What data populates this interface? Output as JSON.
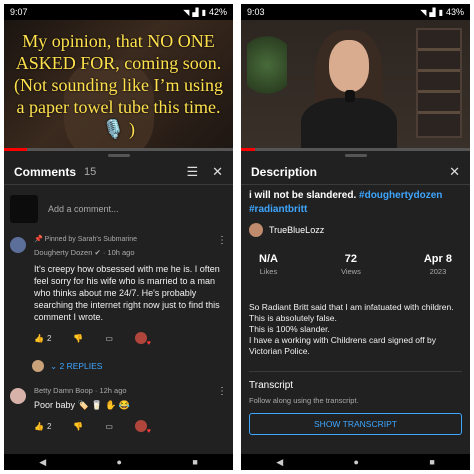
{
  "left": {
    "status": {
      "time": "9:07",
      "battery": "42%"
    },
    "video_overlay": "My opinion, that NO ONE ASKED FOR, coming soon. (Not sounding like I’m using a paper towel tube this time. 🎙️ )",
    "comments_panel": {
      "title": "Comments",
      "count": "15",
      "add_placeholder": "Add a comment...",
      "comments": [
        {
          "pinned": "Pinned by Sarah's Submarine",
          "author": "Dougherty Dozen ✔ · 10h ago",
          "text": "It's creepy how obsessed with me he is. I often feel sorry for his wife who is married to a man who thinks about me 24/7. He's probably searching the internet right now just to find this comment I wrote.",
          "likes": "2",
          "replies": "2 REPLIES"
        },
        {
          "author": "Betty Damn Boop · 12h ago",
          "text": "Poor baby 🏷️ 🥛 ✋ 😂",
          "likes": "2"
        }
      ]
    }
  },
  "right": {
    "status": {
      "time": "9:03",
      "battery": "43%"
    },
    "description_panel": {
      "title": "Description",
      "heading": "i will not be slandered.",
      "hashtags": [
        "#doughertydozen",
        "#radiantbritt"
      ],
      "channel": "TrueBlueLozz",
      "stats": [
        {
          "value": "N/A",
          "label": "Likes"
        },
        {
          "value": "72",
          "label": "Views"
        },
        {
          "value": "Apr 8",
          "label": "2023"
        }
      ],
      "text_lines": [
        "So Radiant Britt said that I am infatuated with children.  This is absolutely false.",
        "This is 100% slander.",
        "I have a working with Childrens card signed off by Victorian Police."
      ],
      "transcript": {
        "title": "Transcript",
        "subtitle": "Follow along using the transcript.",
        "button": "SHOW TRANSCRIPT"
      }
    }
  },
  "colors": {
    "link": "#3ea6ff",
    "background": "#212121",
    "progress": "#ff0000"
  },
  "icons": [
    "wifi-icon",
    "signal-icon",
    "battery-icon",
    "filter-icon",
    "close-icon",
    "thumb-up-icon",
    "thumb-down-icon",
    "reply-icon",
    "more-vert-icon",
    "back-icon",
    "home-icon",
    "recents-icon"
  ]
}
